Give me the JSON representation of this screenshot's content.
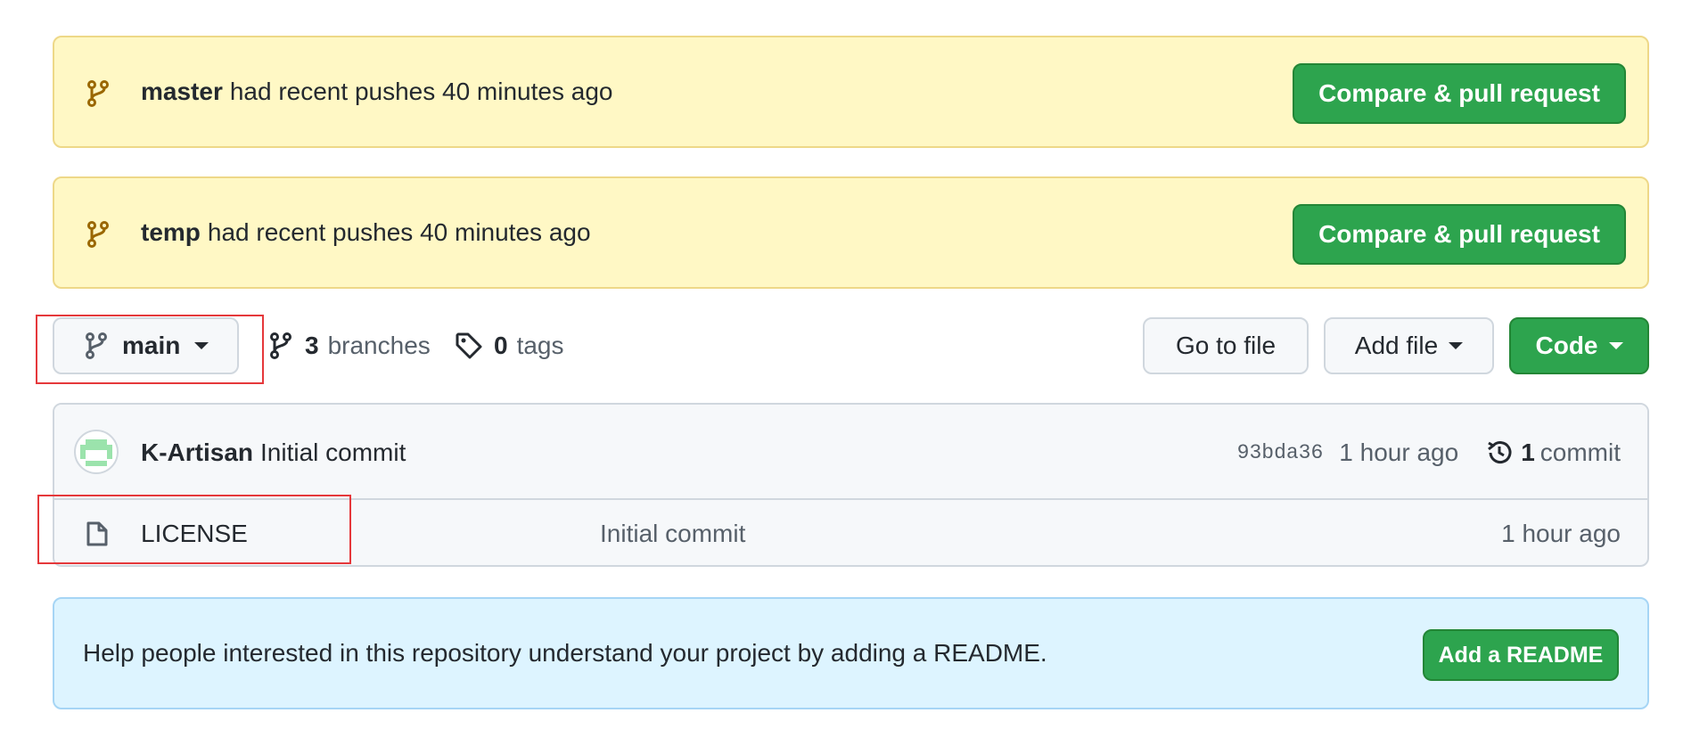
{
  "banners": [
    {
      "branch": "master",
      "message": "had recent pushes 40 minutes ago",
      "button": "Compare & pull request"
    },
    {
      "branch": "temp",
      "message": "had recent pushes 40 minutes ago",
      "button": "Compare & pull request"
    }
  ],
  "toolbar": {
    "branch_select": "main",
    "branches_count": "3",
    "branches_label": "branches",
    "tags_count": "0",
    "tags_label": "tags",
    "go_to_file": "Go to file",
    "add_file": "Add file",
    "code": "Code"
  },
  "commit": {
    "author": "K-Artisan",
    "message": "Initial commit",
    "hash": "93bda36",
    "time": "1 hour ago",
    "commit_count": "1",
    "commit_label": "commit"
  },
  "files": [
    {
      "name": "LICENSE",
      "message": "Initial commit",
      "time": "1 hour ago",
      "icon": "file-icon"
    }
  ],
  "readme": {
    "text": "Help people interested in this repository understand your project by adding a README.",
    "button": "Add a README"
  },
  "colors": {
    "green": "#2da44e",
    "banner_bg": "#fff8c5",
    "readme_bg": "#ddf4ff",
    "highlight": "#e5383b"
  }
}
